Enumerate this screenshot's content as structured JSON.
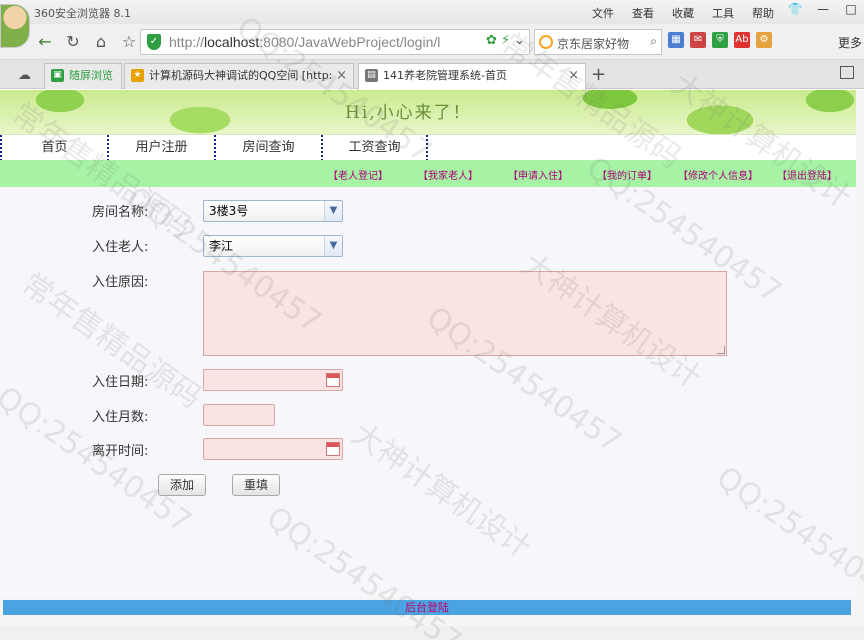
{
  "browser": {
    "title": "360安全浏览器 8.1",
    "menu": [
      "文件",
      "查看",
      "收藏",
      "工具",
      "帮助"
    ],
    "url_prefix": "http://",
    "url_host": "localhost",
    "url_rest": ":8080/JavaWebProject/login/l",
    "search_text": "京东居家好物",
    "more_label": "更多"
  },
  "tabs": [
    {
      "label": "随屏浏览",
      "color": "#2ea043"
    },
    {
      "label": "计算机源码大神调试的QQ空间 [http:",
      "color": "#e8a200"
    },
    {
      "label": "141养老院管理系统-首页",
      "color": "#777"
    }
  ],
  "site": {
    "banner_sub": "Hi,小心来了！",
    "nav": [
      "首页",
      "用户注册",
      "房间查询",
      "工资查询"
    ],
    "subnav": [
      "【老人登记】",
      "【我家老人】",
      "【申请入住】",
      "【我的订单】",
      "【修改个人信息】",
      "【退出登陆】"
    ],
    "footer": "后台登陆"
  },
  "form": {
    "room_label": "房间名称:",
    "room_value": "3楼3号",
    "elder_label": "入住老人:",
    "elder_value": "李江",
    "reason_label": "入住原因:",
    "date_label": "入住日期:",
    "months_label": "入住月数:",
    "leave_label": "离开时间:",
    "add_button": "添加",
    "reset_button": "重填"
  },
  "watermarks": [
    "QQ:254540457",
    "常年售精品源码",
    "大神计算机设计"
  ]
}
